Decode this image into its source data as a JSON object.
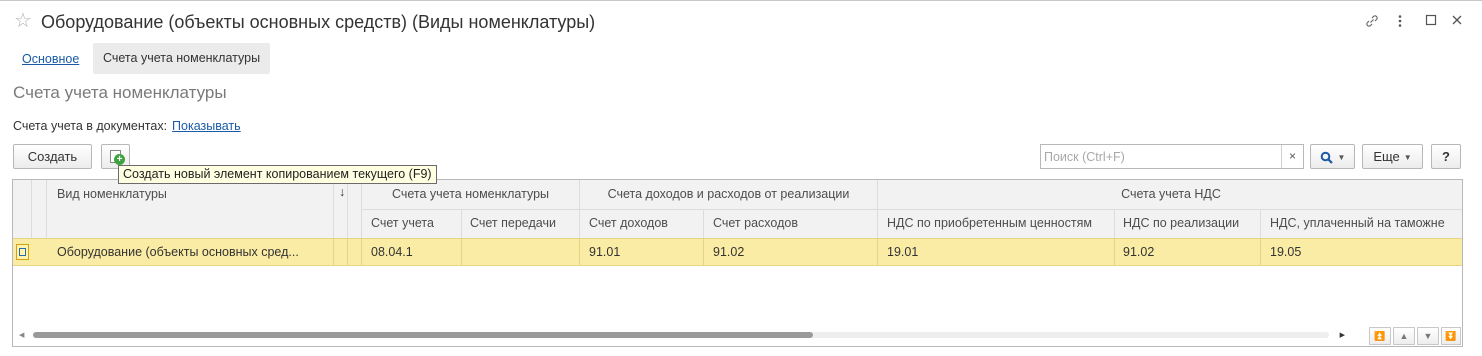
{
  "window": {
    "title": "Оборудование (объекты основных средств) (Виды номенклатуры)",
    "icons": [
      "star-icon",
      "link-icon",
      "more-vert-icon",
      "maximize-icon",
      "close-icon"
    ]
  },
  "tabs": {
    "main": "Основное",
    "accounts": "Счета учета номенклатуры"
  },
  "section_title": "Счета учета номенклатуры",
  "docs": {
    "label": "Счета учета в документах:",
    "link": "Показывать"
  },
  "toolbar": {
    "create": "Создать",
    "copy_tooltip": "Создать новый элемент копированием текущего (F9)",
    "search_placeholder": "Поиск (Ctrl+F)",
    "search_clear": "×",
    "more": "Еще",
    "help": "?"
  },
  "table": {
    "header": {
      "vid": "Вид номенклатуры",
      "sort_arrow": "↓",
      "group1": "Счета учета номенклатуры",
      "group2": "Счета доходов и расходов от реализации",
      "group3": "Счета учета НДС",
      "c1": "Счет учета",
      "c2": "Счет передачи",
      "c3": "Счет доходов",
      "c4": "Счет расходов",
      "c5": "НДС по приобретенным ценностям",
      "c6": "НДС по реализации",
      "c7": "НДС, уплаченный на таможне"
    },
    "rows": [
      {
        "vid": "Оборудование (объекты основных сред...",
        "c1": "08.04.1",
        "c2": "",
        "c3": "91.01",
        "c4": "91.02",
        "c5": "19.01",
        "c6": "91.02",
        "c7": "19.05"
      }
    ]
  },
  "colors": {
    "selected_row": "#fbeca5",
    "link": "#1a5aa6",
    "header_bg": "#f2f2f2"
  }
}
